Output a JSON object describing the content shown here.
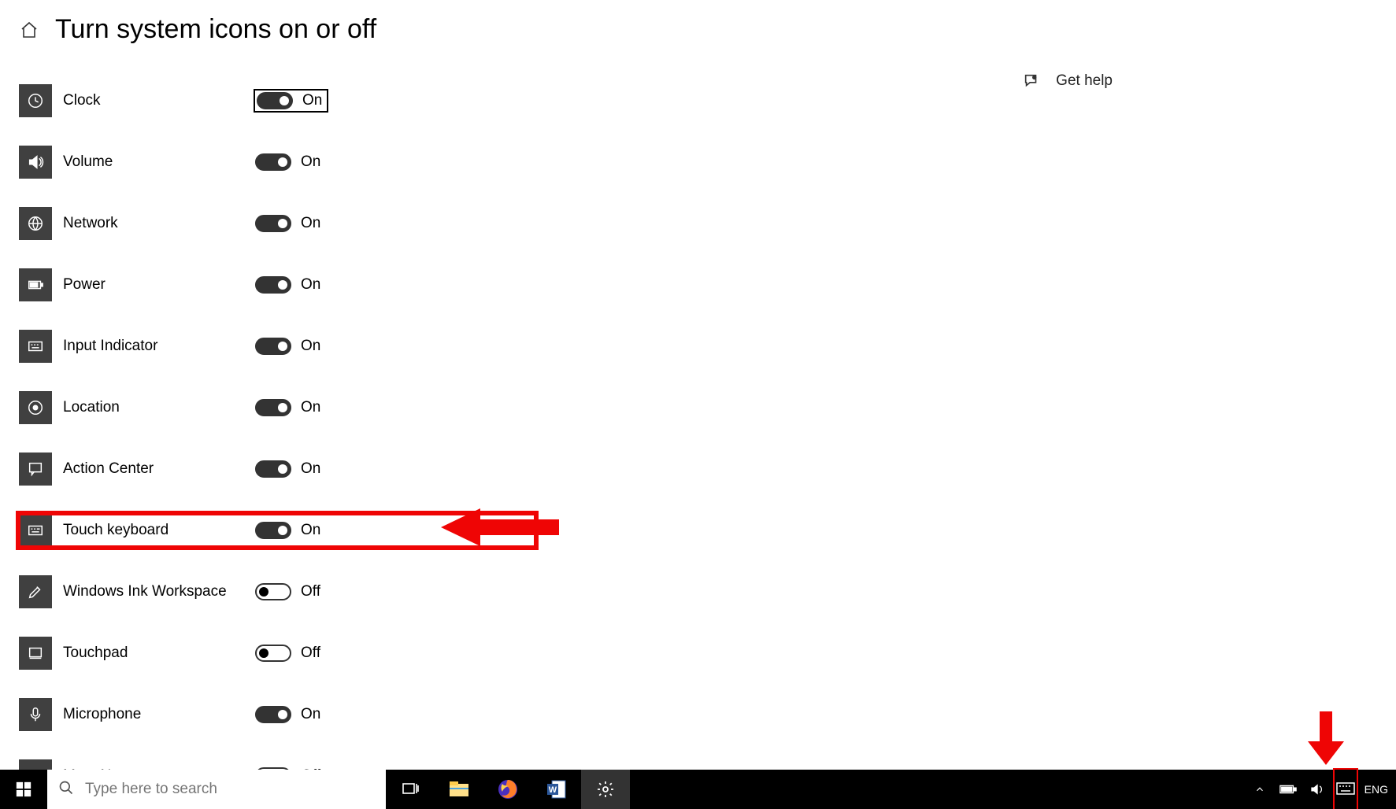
{
  "header": {
    "title": "Turn system icons on or off"
  },
  "help": {
    "label": "Get help"
  },
  "settings": [
    {
      "icon": "clock-icon",
      "label": "Clock",
      "on": true,
      "state": "On",
      "focused": true,
      "highlight": false
    },
    {
      "icon": "volume-icon",
      "label": "Volume",
      "on": true,
      "state": "On",
      "focused": false,
      "highlight": false
    },
    {
      "icon": "network-icon",
      "label": "Network",
      "on": true,
      "state": "On",
      "focused": false,
      "highlight": false
    },
    {
      "icon": "power-icon",
      "label": "Power",
      "on": true,
      "state": "On",
      "focused": false,
      "highlight": false
    },
    {
      "icon": "input-indicator-icon",
      "label": "Input Indicator",
      "on": true,
      "state": "On",
      "focused": false,
      "highlight": false
    },
    {
      "icon": "location-icon",
      "label": "Location",
      "on": true,
      "state": "On",
      "focused": false,
      "highlight": false
    },
    {
      "icon": "action-center-icon",
      "label": "Action Center",
      "on": true,
      "state": "On",
      "focused": false,
      "highlight": false
    },
    {
      "icon": "touch-keyboard-icon",
      "label": "Touch keyboard",
      "on": true,
      "state": "On",
      "focused": false,
      "highlight": true
    },
    {
      "icon": "windows-ink-icon",
      "label": "Windows Ink Workspace",
      "on": false,
      "state": "Off",
      "focused": false,
      "highlight": false
    },
    {
      "icon": "touchpad-icon",
      "label": "Touchpad",
      "on": false,
      "state": "Off",
      "focused": false,
      "highlight": false
    },
    {
      "icon": "microphone-icon",
      "label": "Microphone",
      "on": true,
      "state": "On",
      "focused": false,
      "highlight": false
    },
    {
      "icon": "meet-now-icon",
      "label": "Meet Now",
      "on": false,
      "state": "Off",
      "focused": false,
      "highlight": false
    }
  ],
  "taskbar": {
    "search_placeholder": "Type here to search",
    "lang": "ENG",
    "apps": [
      {
        "name": "task-view-icon"
      },
      {
        "name": "file-explorer-icon"
      },
      {
        "name": "firefox-icon"
      },
      {
        "name": "word-icon"
      },
      {
        "name": "settings-icon",
        "active": true
      }
    ]
  },
  "annotations": {
    "arrow_left": true,
    "arrow_down": true,
    "highlight_touch_keyboard": true,
    "highlight_tray_keyboard": true
  }
}
